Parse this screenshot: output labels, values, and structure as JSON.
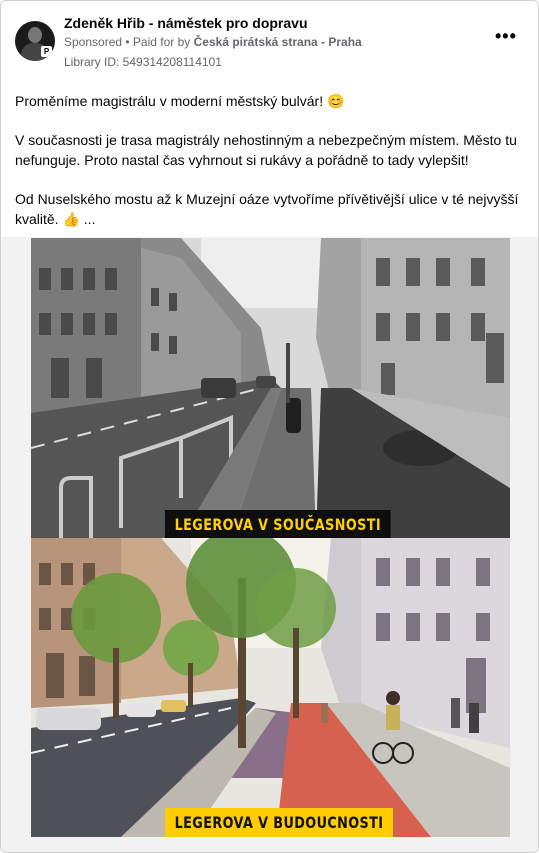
{
  "post": {
    "author": "Zdeněk Hřib - náměstek pro dopravu",
    "sponsored_label": "Sponsored",
    "paid_for_label": " • Paid for by ",
    "paid_for_name": "Česká pirátská strana - Praha",
    "library_id": "Library ID: 549314208114101",
    "more_label": "•••",
    "paragraphs": [
      "Proměníme magistrálu v moderní městský bulvár! 😊",
      "V současnosti je trasa magistrály nehostinným a nebezpečným místem. Město tu nefunguje. Proto nastal čas vyhrnout si rukávy a pořádně to tady vylepšit!",
      "Od Nuselského mostu až k Muzejní oáze vytvoříme přívětivější ulice v té nejvyšší kvalitě. 👍 ..."
    ]
  },
  "image": {
    "caption_current": "LEGEROVA V SOUČASNOSTI",
    "caption_future": "LEGEROVA V BUDOUCNOSTI"
  },
  "colors": {
    "caption_current_bg": "#0e0e0e",
    "caption_current_text": "#ffd000",
    "caption_future_bg": "#ffcc00",
    "bike_lane": "#d6614f"
  },
  "icons": {
    "more": "more-horizontal-icon"
  }
}
